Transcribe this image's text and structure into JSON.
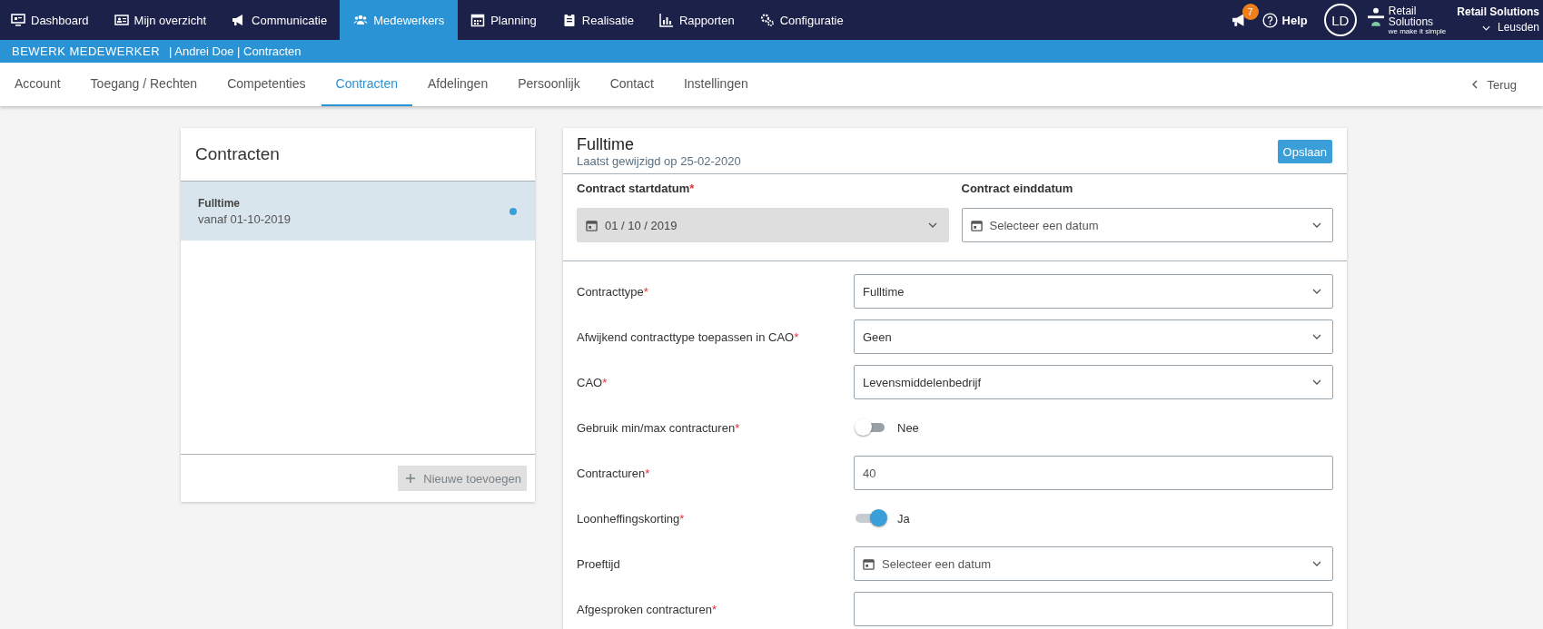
{
  "nav": {
    "items": [
      {
        "label": "Dashboard",
        "selected": false
      },
      {
        "label": "Mijn overzicht",
        "selected": false
      },
      {
        "label": "Communicatie",
        "selected": false
      },
      {
        "label": "Medewerkers",
        "selected": true
      },
      {
        "label": "Planning",
        "selected": false
      },
      {
        "label": "Realisatie",
        "selected": false
      },
      {
        "label": "Rapporten",
        "selected": false
      },
      {
        "label": "Configuratie",
        "selected": false
      }
    ],
    "notifications": "7",
    "help": "Help",
    "avatar": "LD",
    "logo": {
      "line1": "Retail",
      "line2": "Solutions",
      "tagline": "we make it simple"
    },
    "org": {
      "name": "Retail Solutions",
      "location": "Leusden"
    }
  },
  "breadcrumb": {
    "title": "BEWERK MEDEWERKER",
    "path": "| Andrei Doe | Contracten"
  },
  "tabs": [
    {
      "label": "Account",
      "selected": false
    },
    {
      "label": "Toegang / Rechten",
      "selected": false
    },
    {
      "label": "Competenties",
      "selected": false
    },
    {
      "label": "Contracten",
      "selected": true
    },
    {
      "label": "Afdelingen",
      "selected": false
    },
    {
      "label": "Persoonlijk",
      "selected": false
    },
    {
      "label": "Contact",
      "selected": false
    },
    {
      "label": "Instellingen",
      "selected": false
    }
  ],
  "back": "Terug",
  "contracts_panel": {
    "title": "Contracten",
    "items": [
      {
        "name": "Fulltime",
        "from": "vanaf 01-10-2019",
        "selected": true,
        "active": true
      }
    ],
    "add_button": "Nieuwe toevoegen",
    "add_disabled": true
  },
  "detail": {
    "title": "Fulltime",
    "subtitle": "Laatst gewijzigd op 25-02-2020",
    "save": "Opslaan",
    "required_mark": "*",
    "dates": [
      {
        "label": "Contract startdatum",
        "required": true,
        "value": "01 / 10 / 2019",
        "disabled": true
      },
      {
        "label": "Contract einddatum",
        "required": false,
        "placeholder": "Selecteer een datum",
        "disabled": false
      }
    ],
    "fields": [
      {
        "kind": "select",
        "label": "Contracttype",
        "required": true,
        "value": "Fulltime"
      },
      {
        "kind": "select",
        "label": "Afwijkend contracttype toepassen in CAO",
        "required": true,
        "value": "Geen"
      },
      {
        "kind": "select",
        "label": "CAO",
        "required": true,
        "value": "Levensmiddelenbedrijf"
      },
      {
        "kind": "toggle",
        "label": "Gebruik min/max contracturen",
        "required": true,
        "on": false,
        "text": "Nee"
      },
      {
        "kind": "text",
        "label": "Contracturen",
        "required": true,
        "value": "40"
      },
      {
        "kind": "toggle",
        "label": "Loonheffingskorting",
        "required": true,
        "on": true,
        "text": "Ja"
      },
      {
        "kind": "date",
        "label": "Proeftijd",
        "required": false,
        "placeholder": "Selecteer een datum"
      },
      {
        "kind": "text",
        "label": "Afgesproken contracturen",
        "required": true
      }
    ]
  }
}
